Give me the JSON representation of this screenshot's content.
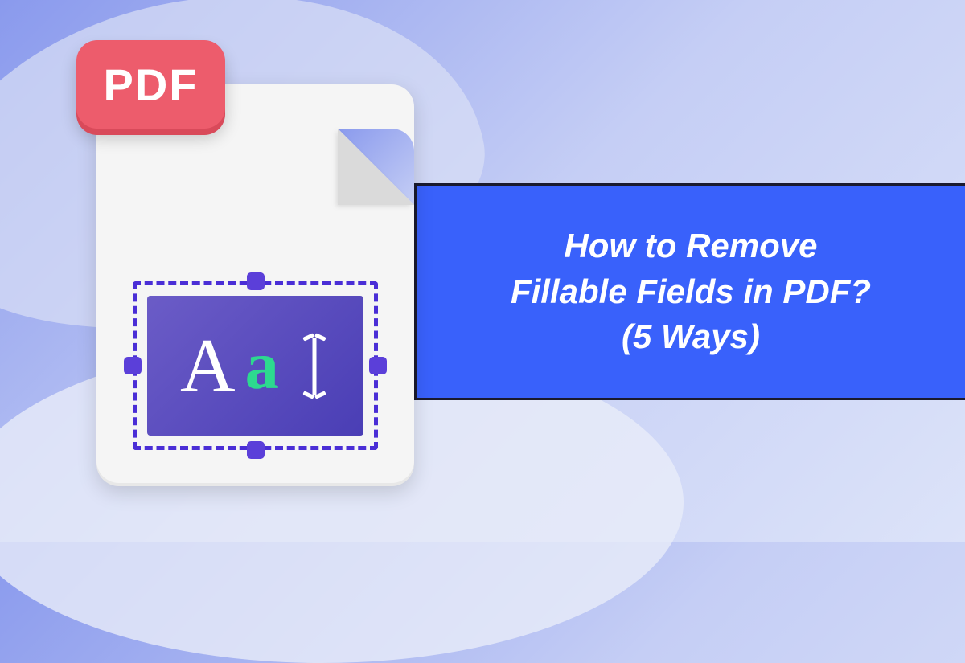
{
  "banner": {
    "title_line1": "How to Remove",
    "title_line2": "Fillable Fields in PDF?",
    "title_line3": "(5 Ways)"
  },
  "badge": {
    "label": "PDF"
  },
  "field_preview": {
    "sample_upper": "A",
    "sample_lower": "a"
  },
  "colors": {
    "banner_bg": "#3961fb",
    "badge_bg": "#ed5c6c",
    "accent_purple": "#5b3fd9",
    "accent_green": "#2dd98f"
  }
}
